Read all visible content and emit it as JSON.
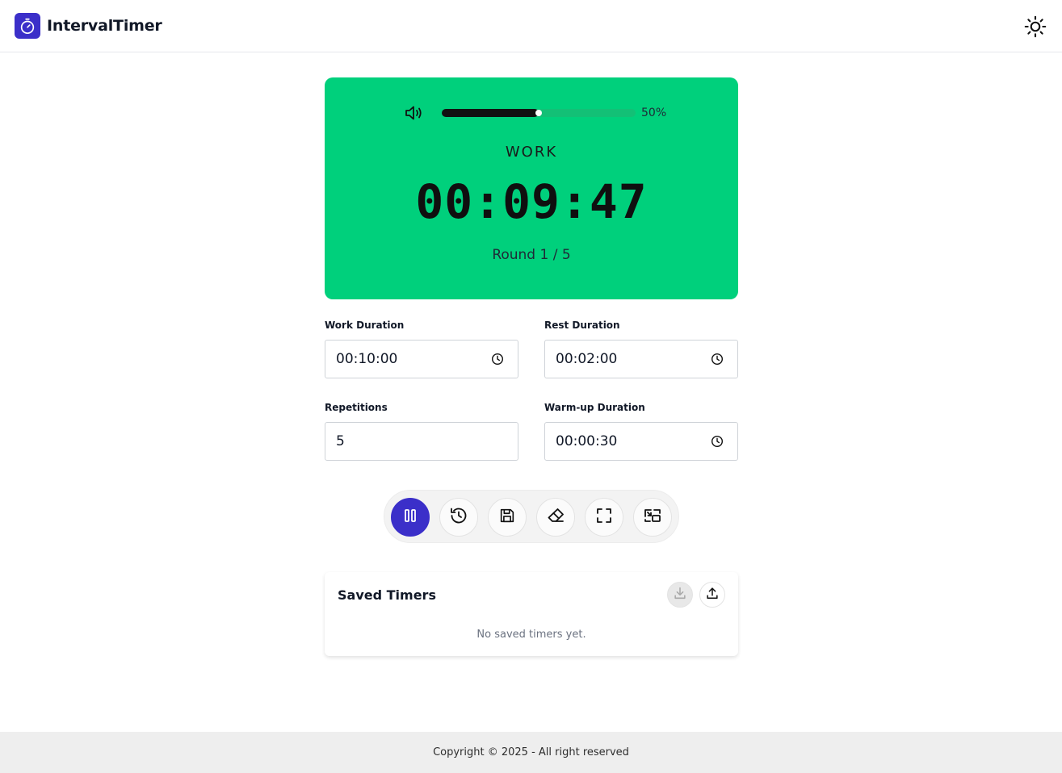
{
  "app": {
    "name": "IntervalTimer",
    "logo_icon": "stopwatch-icon",
    "theme_icon": "sun-icon",
    "accent_color": "#3b2fc9"
  },
  "timer": {
    "background_color": "#00d07c",
    "volume_icon": "speaker-icon",
    "volume_percent": 50,
    "volume_label": "50%",
    "phase": "WORK",
    "time": "00:09:47",
    "round_label": "Round 1 / 5"
  },
  "form": {
    "work": {
      "label": "Work Duration",
      "value": "00:10:00",
      "icon": "clock-icon"
    },
    "rest": {
      "label": "Rest Duration",
      "value": "00:02:00",
      "icon": "clock-icon"
    },
    "repetitions": {
      "label": "Repetitions",
      "value": "5"
    },
    "warmup": {
      "label": "Warm-up Duration",
      "value": "00:00:30",
      "icon": "clock-icon"
    }
  },
  "toolbar": {
    "buttons": [
      {
        "icon": "pause-icon",
        "active": true
      },
      {
        "icon": "history-icon",
        "active": false
      },
      {
        "icon": "save-icon",
        "active": false
      },
      {
        "icon": "eraser-icon",
        "active": false
      },
      {
        "icon": "fullscreen-icon",
        "active": false
      },
      {
        "icon": "picture-in-picture-icon",
        "active": false
      }
    ]
  },
  "saved": {
    "title": "Saved Timers",
    "import_icon": "download-icon",
    "export_icon": "upload-icon",
    "empty_message": "No saved timers yet."
  },
  "footer": {
    "text": "Copyright © 2025 - All right reserved"
  }
}
